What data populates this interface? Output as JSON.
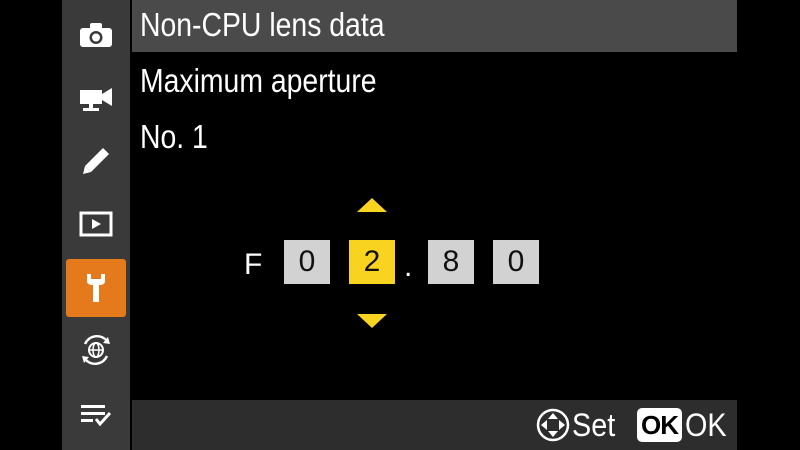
{
  "header": {
    "title": "Non-CPU lens data"
  },
  "body": {
    "line1": "Maximum aperture",
    "line2": "No. 1"
  },
  "aperture": {
    "prefix": "F",
    "digits": [
      "0",
      "2",
      "8",
      "0"
    ],
    "separator": ".",
    "selected_index": 1
  },
  "sidebar": {
    "items": [
      {
        "icon": "camera-icon"
      },
      {
        "icon": "movie-camera-icon"
      },
      {
        "icon": "pencil-icon"
      },
      {
        "icon": "playback-icon"
      },
      {
        "icon": "wrench-icon",
        "active": true
      },
      {
        "icon": "network-icon"
      },
      {
        "icon": "my-menu-icon"
      }
    ]
  },
  "footer": {
    "set_label": "Set",
    "ok_badge": "OK",
    "ok_label": "OK"
  },
  "colors": {
    "accent": "#e57a1c",
    "highlight": "#f8d31f",
    "sidebar": "#3a3a3a",
    "title_bar": "#4a4a4a"
  }
}
